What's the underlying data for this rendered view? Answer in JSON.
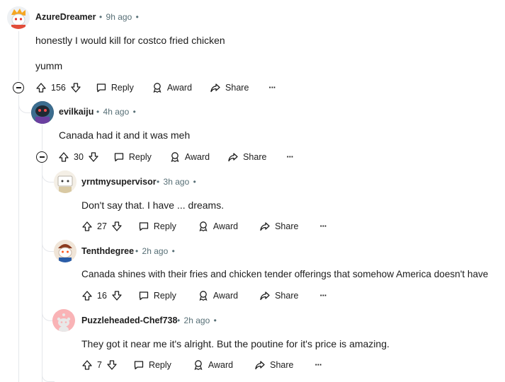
{
  "comments": [
    {
      "username": "AzureDreamer",
      "time": "9h ago",
      "text": [
        "honestly I would kill for costco fried chicken",
        "yumm"
      ],
      "score": "156"
    },
    {
      "username": "evilkaiju",
      "time": "4h ago",
      "text": [
        "Canada had it and it was meh"
      ],
      "score": "30"
    },
    {
      "username": "yrntmysupervisor",
      "time": "3h ago",
      "text": [
        "Don't say that. I have ... dreams."
      ],
      "score": "27"
    },
    {
      "username": "Tenthdegree",
      "time": "2h ago",
      "text": [
        "Canada shines with their fries and chicken tender offerings that somehow America doesn't have"
      ],
      "score": "16"
    },
    {
      "username": "Puzzleheaded-Chef738",
      "time": "2h ago",
      "text": [
        "They got it near me it's alright. But the poutine for it's price is amazing."
      ],
      "score": "7"
    }
  ],
  "actions": {
    "reply": "Reply",
    "award": "Award",
    "share": "Share",
    "more": "···",
    "dot": "•",
    "sep": "•"
  },
  "colors": {
    "meta": "#576f76",
    "thread": "#e5e7eb",
    "text": "#1c1c1c"
  }
}
